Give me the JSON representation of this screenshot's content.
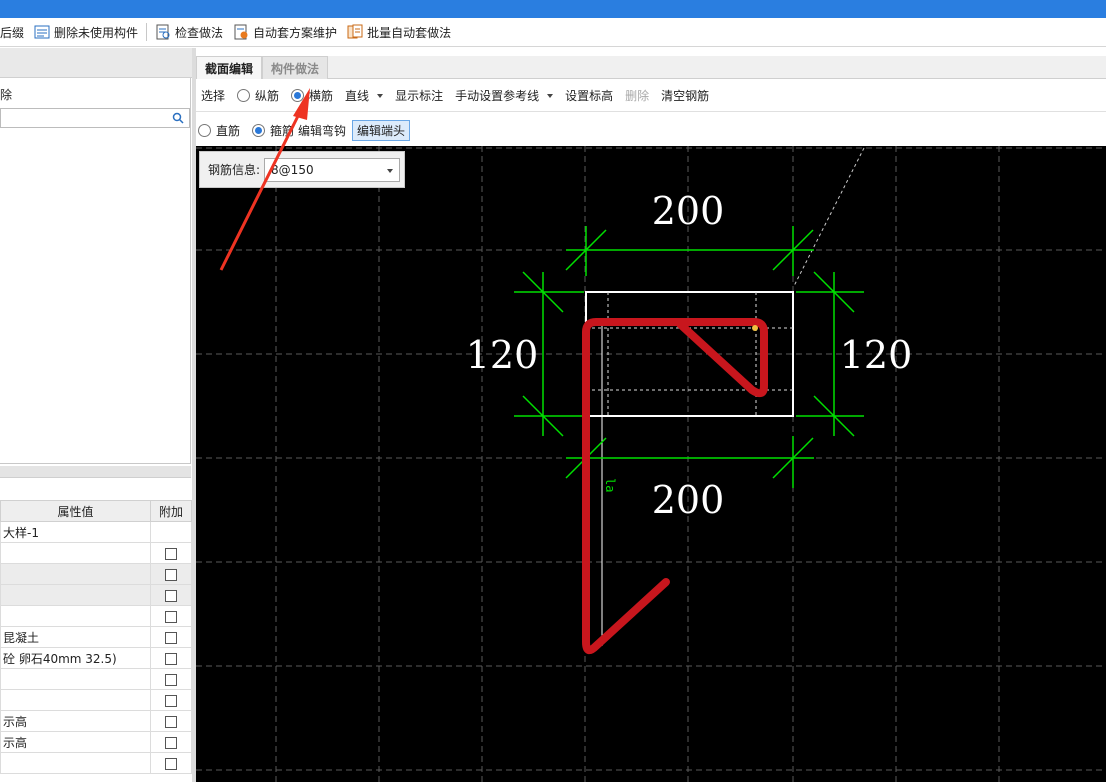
{
  "toolbar": {
    "items": [
      {
        "label": "后缀",
        "icon": "suffix-icon"
      },
      {
        "label": "删除未使用构件",
        "icon": "delete-unused-icon"
      },
      {
        "label": "检查做法",
        "icon": "check-method-icon"
      },
      {
        "label": "自动套方案维护",
        "icon": "auto-scheme-icon"
      },
      {
        "label": "批量自动套做法",
        "icon": "batch-auto-icon"
      }
    ]
  },
  "left_panel": {
    "delete_label": "除",
    "search_placeholder": ""
  },
  "properties": {
    "headers": {
      "value": "属性值",
      "extra": "附加"
    },
    "rows": [
      {
        "value": "大样-1",
        "has_check": false
      },
      {
        "value": "",
        "has_check": true
      },
      {
        "value": "",
        "has_check": true
      },
      {
        "value": "",
        "has_check": true
      },
      {
        "value": "",
        "has_check": true
      },
      {
        "value": "昆凝土",
        "has_check": true
      },
      {
        "value": "砼 卵石40mm 32.5)",
        "has_check": true
      },
      {
        "value": "",
        "has_check": true
      },
      {
        "value": "",
        "has_check": true
      },
      {
        "value": "示高",
        "has_check": true
      },
      {
        "value": "示高",
        "has_check": true
      },
      {
        "value": "",
        "has_check": true
      }
    ]
  },
  "tabs": [
    {
      "label": "截面编辑",
      "active": true
    },
    {
      "label": "构件做法",
      "active": false
    }
  ],
  "draw_toolbar": {
    "select": "选择",
    "longitudinal": "纵筋",
    "transverse": "横筋",
    "line": "直线",
    "show_dim": "显示标注",
    "manual_ref": "手动设置参考线",
    "set_elev": "设置标高",
    "delete": "删除",
    "clear": "清空钢筋",
    "selected_radio": "transverse"
  },
  "sub_toolbar": {
    "straight": "直筋",
    "stirrup": "箍筋",
    "edit_hook": "编辑弯钩",
    "edit_end": "编辑端头",
    "selected_radio": "stirrup"
  },
  "rebar_info": {
    "label": "钢筋信息:",
    "value": "8@150"
  },
  "drawing": {
    "dim_top": "200",
    "dim_bottom": "200",
    "dim_left": "120",
    "dim_right": "120",
    "anchor_label": "la",
    "colors": {
      "dimension": "#00e000",
      "rebar": "#c8161d",
      "outline": "#ffffff",
      "grid": "#5a5a5a",
      "arrow": "#ee3322"
    }
  }
}
